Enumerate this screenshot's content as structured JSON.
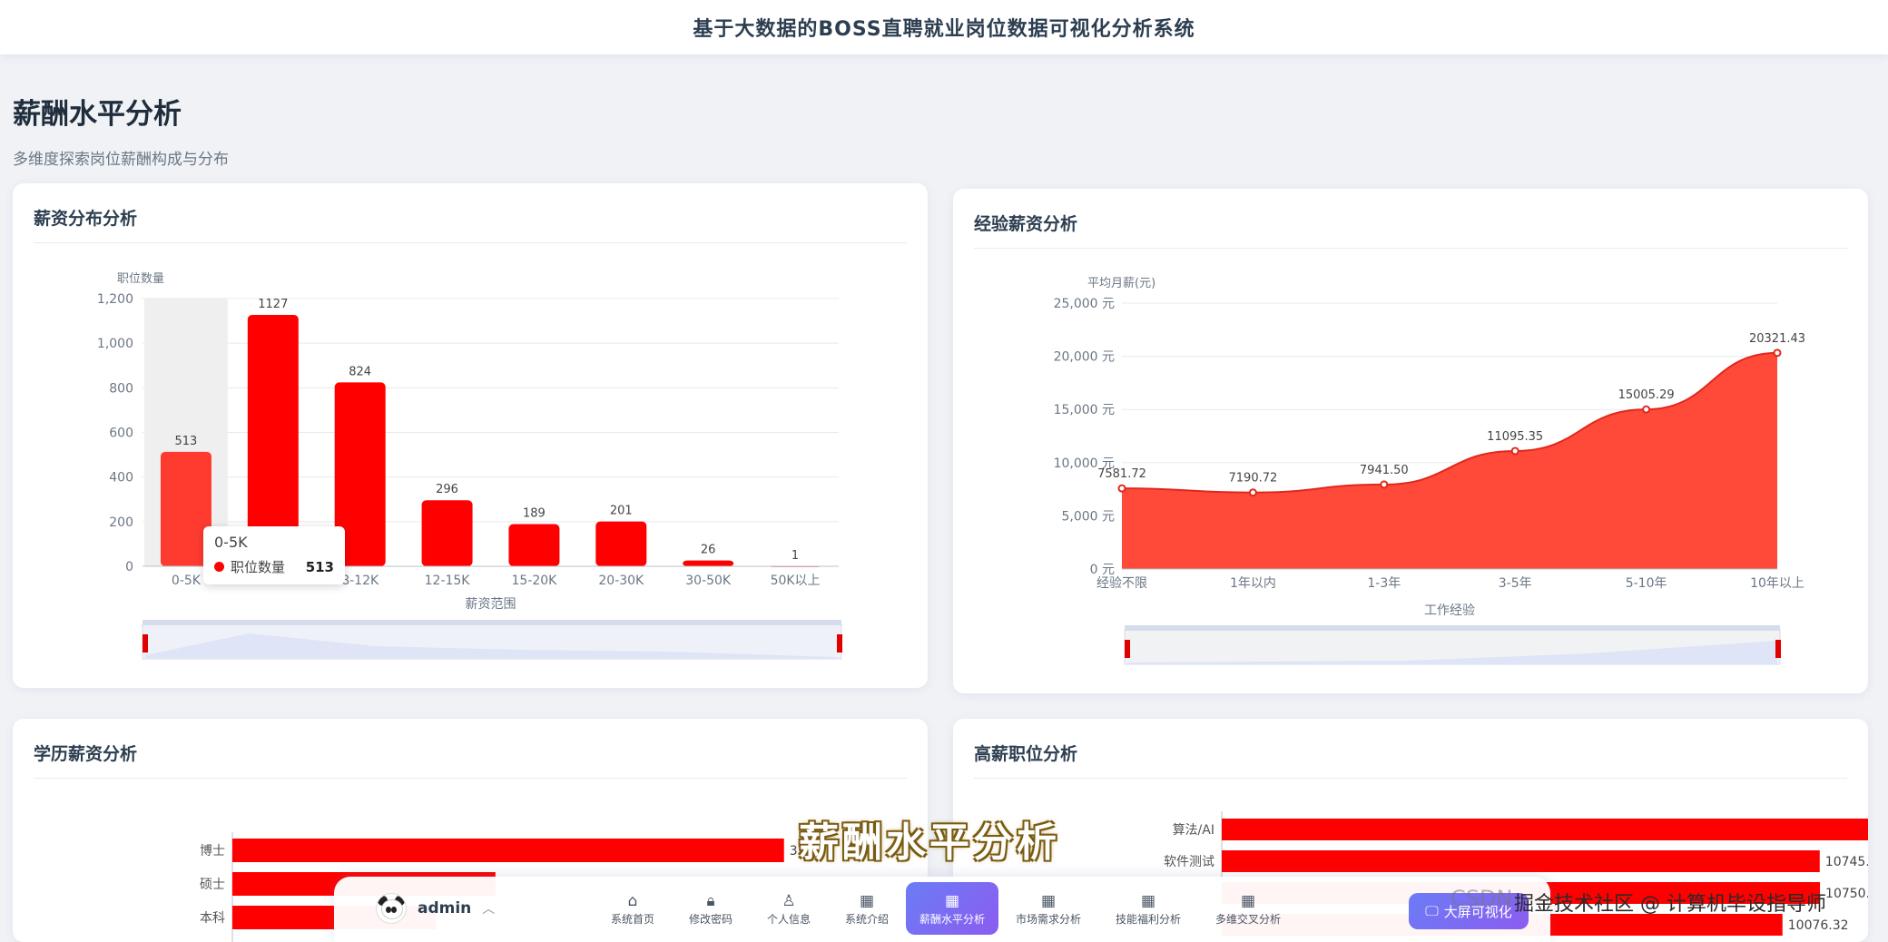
{
  "app": {
    "title": "基于大数据的BOSS直聘就业岗位数据可视化分析系统"
  },
  "page": {
    "title": "薪酬水平分析",
    "subtitle": "多维度探索岗位薪酬构成与分布"
  },
  "cards": {
    "salary_dist": {
      "title": "薪资分布分析"
    },
    "experience": {
      "title": "经验薪资分析"
    },
    "education": {
      "title": "学历薪资分析"
    },
    "high_pay": {
      "title": "高薪职位分析"
    }
  },
  "tooltip": {
    "category": "0-5K",
    "series": "职位数量",
    "value": "513"
  },
  "overlay": {
    "caption": "薪酬水平分析"
  },
  "watermark": {
    "text": "CSDN",
    "text2": "掘金技术社区 @ 计算机毕设指导师"
  },
  "dock": {
    "user": "admin",
    "items": [
      {
        "label": "系统首页",
        "icon": "home-icon"
      },
      {
        "label": "修改密码",
        "icon": "lock-icon"
      },
      {
        "label": "个人信息",
        "icon": "user-icon"
      },
      {
        "label": "系统介绍",
        "icon": "grid-icon"
      },
      {
        "label": "薪酬水平分析",
        "icon": "grid-icon"
      },
      {
        "label": "市场需求分析",
        "icon": "grid-icon"
      },
      {
        "label": "技能福利分析",
        "icon": "grid-icon"
      },
      {
        "label": "多维交叉分析",
        "icon": "grid-icon"
      }
    ],
    "bigscreen_label": "大屏可视化"
  },
  "chart_data": [
    {
      "type": "bar",
      "title": "薪资分布分析",
      "xlabel": "薪资范围",
      "ylabel": "职位数量",
      "categories": [
        "0-5K",
        "5-8K",
        "8-12K",
        "12-15K",
        "15-20K",
        "20-30K",
        "30-50K",
        "50K以上"
      ],
      "values": [
        513,
        1127,
        824,
        296,
        189,
        201,
        26,
        1
      ],
      "ylim": [
        0,
        1200
      ],
      "yticks": [
        "0",
        "200",
        "400",
        "600",
        "800",
        "1,000",
        "1,200"
      ],
      "color": "#ff0000",
      "highlight_color": "#ff3b2f",
      "grid": true
    },
    {
      "type": "area",
      "title": "经验薪资分析",
      "xlabel": "工作经验",
      "ylabel": "平均月薪(元)",
      "categories": [
        "经验不限",
        "1年以内",
        "1-3年",
        "3-5年",
        "5-10年",
        "10年以上"
      ],
      "values": [
        7581.72,
        7190.72,
        7941.5,
        11095.35,
        15005.29,
        20321.43
      ],
      "labels": [
        "7581.72",
        "7190.72",
        "7941.50",
        "11095.35",
        "15005.29",
        "20321.43"
      ],
      "ylim": [
        0,
        25000
      ],
      "yticks": [
        "0 元",
        "5,000 元",
        "10,000 元",
        "15,000 元",
        "20,000 元",
        "25,000 元"
      ],
      "color": "#ff3b2f",
      "grid": true
    },
    {
      "type": "bar",
      "title": "学历薪资分析",
      "orientation": "horizontal",
      "categories": [
        "博士",
        "硕士",
        "本科"
      ],
      "values": [
        325,
        155,
        120
      ],
      "labels": [
        "325",
        "",
        ""
      ],
      "xlim": [
        0,
        400
      ],
      "color": "#ff0000"
    },
    {
      "type": "bar",
      "title": "高薪职位分析",
      "orientation": "horizontal",
      "categories": [
        "算法/AI",
        "软件测试",
        "",
        ""
      ],
      "values": [
        12632.5,
        10745.5,
        10750.0,
        10076.32
      ],
      "labels": [
        "12632.50",
        "10745.50",
        "10750.00",
        "10076.32"
      ],
      "xlim": [
        0,
        13000
      ],
      "color": "#ff0000"
    }
  ]
}
